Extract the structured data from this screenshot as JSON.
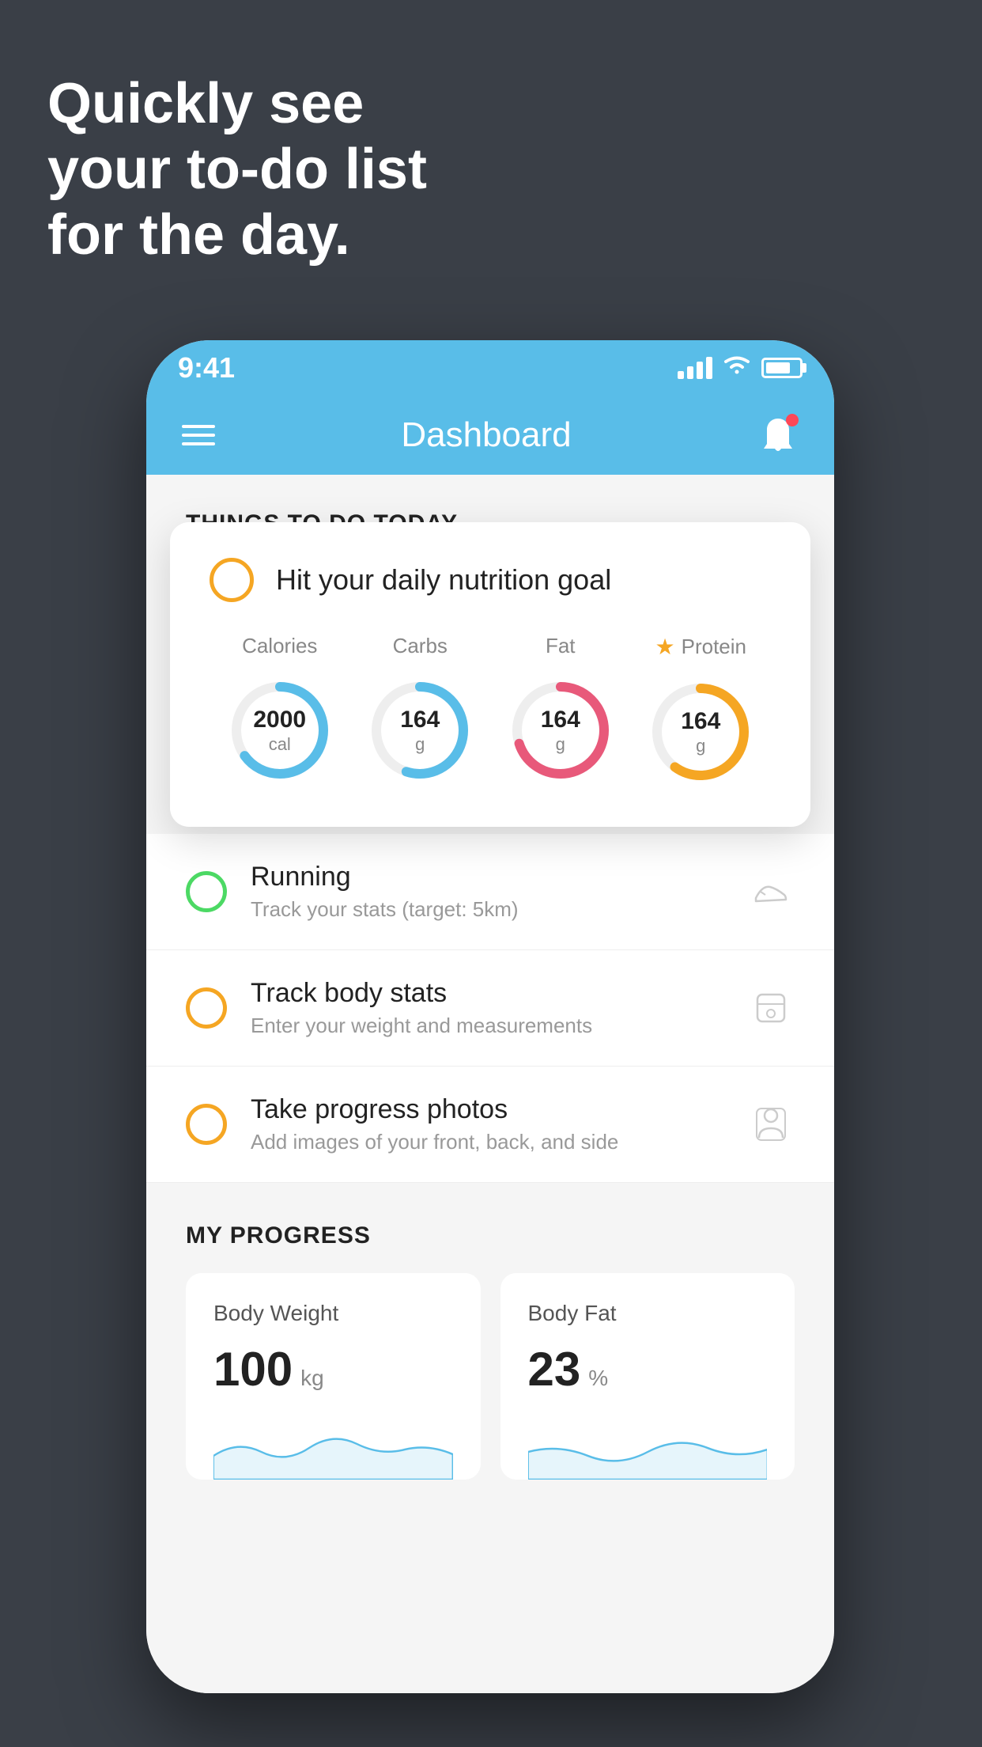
{
  "hero": {
    "line1": "Quickly see",
    "line2": "your to-do list",
    "line3": "for the day."
  },
  "statusBar": {
    "time": "9:41"
  },
  "appHeader": {
    "title": "Dashboard"
  },
  "thingsSection": {
    "title": "THINGS TO DO TODAY"
  },
  "nutritionCard": {
    "title": "Hit your daily nutrition goal",
    "macros": [
      {
        "label": "Calories",
        "value": "2000",
        "unit": "cal",
        "color": "#59bde8",
        "percent": 65,
        "starred": false
      },
      {
        "label": "Carbs",
        "value": "164",
        "unit": "g",
        "color": "#59bde8",
        "percent": 55,
        "starred": false
      },
      {
        "label": "Fat",
        "value": "164",
        "unit": "g",
        "color": "#e8597a",
        "percent": 70,
        "starred": false
      },
      {
        "label": "Protein",
        "value": "164",
        "unit": "g",
        "color": "#f5a623",
        "percent": 60,
        "starred": true
      }
    ]
  },
  "todoItems": [
    {
      "type": "green",
      "title": "Running",
      "subtitle": "Track your stats (target: 5km)",
      "icon": "shoe"
    },
    {
      "type": "yellow",
      "title": "Track body stats",
      "subtitle": "Enter your weight and measurements",
      "icon": "scale"
    },
    {
      "type": "yellow",
      "title": "Take progress photos",
      "subtitle": "Add images of your front, back, and side",
      "icon": "person"
    }
  ],
  "progressSection": {
    "title": "MY PROGRESS",
    "cards": [
      {
        "title": "Body Weight",
        "value": "100",
        "unit": "kg"
      },
      {
        "title": "Body Fat",
        "value": "23",
        "unit": "%"
      }
    ]
  }
}
